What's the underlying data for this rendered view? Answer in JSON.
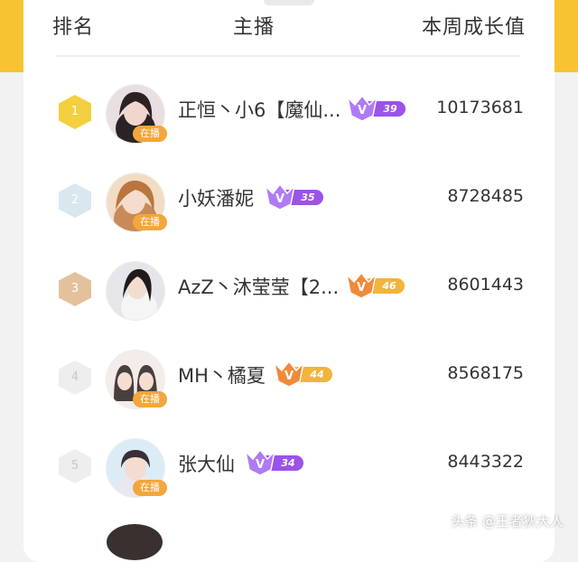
{
  "header": {
    "rank_label": "排名",
    "host_label": "主播",
    "value_label": "本周成长值"
  },
  "rows": [
    {
      "rank": "1",
      "name": "正恒丶小6【魔仙...",
      "level": "39",
      "live": "在播",
      "value": "10173681",
      "rank_color": "#f4cf3f",
      "level_color": "#9b53e8"
    },
    {
      "rank": "2",
      "name": "小妖潘妮",
      "level": "35",
      "live": "在播",
      "value": "8728485",
      "rank_color": "#d9e7ef",
      "level_color": "#9b53e8"
    },
    {
      "rank": "3",
      "name": "AzZ丶沐莹莹【2...",
      "level": "46",
      "live": "在播",
      "value": "8601443",
      "rank_color": "#e2c19c",
      "level_color": "#f2b43c"
    },
    {
      "rank": "4",
      "name": "MH丶橘夏",
      "level": "44",
      "live": "在播",
      "value": "8568175",
      "rank_color": "#eeeeee",
      "level_color": "#f2b43c"
    },
    {
      "rank": "5",
      "name": "张大仙",
      "level": "34",
      "live": "在播",
      "value": "8443322",
      "rank_color": "#eeeeee",
      "level_color": "#9b53e8"
    }
  ],
  "watermark": "头条 @王者狄大人"
}
